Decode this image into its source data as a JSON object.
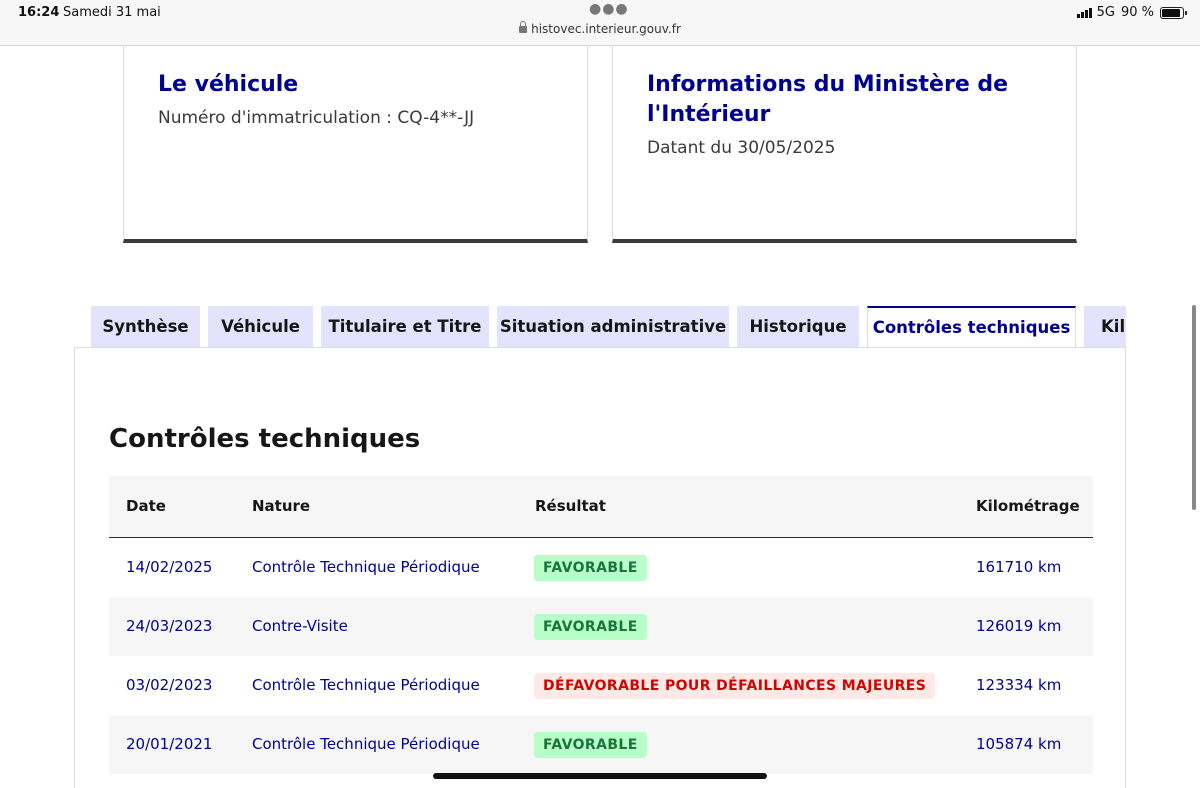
{
  "status_bar": {
    "time": "16:24",
    "date": "Samedi 31 mai",
    "url": "histovec.interieur.gouv.fr",
    "network": "5G",
    "battery": "90 %",
    "battery_level": 0.9
  },
  "cards": {
    "vehicle": {
      "title": "Le véhicule",
      "text": "Numéro d'immatriculation : CQ-4**-JJ"
    },
    "ministry": {
      "title_line1": "Informations du Ministère de",
      "title_line2": "l'Intérieur",
      "text": "Datant du 30/05/2025"
    }
  },
  "tabs": [
    {
      "label": "Synthèse",
      "active": false
    },
    {
      "label": "Véhicule",
      "active": false
    },
    {
      "label": "Titulaire et Titre",
      "active": false
    },
    {
      "label": "Situation administrative",
      "active": false
    },
    {
      "label": "Historique",
      "active": false
    },
    {
      "label": "Contrôles techniques",
      "active": true
    },
    {
      "label": "Kil",
      "active": false
    }
  ],
  "section": {
    "title": "Contrôles techniques",
    "columns": [
      "Date",
      "Nature",
      "Résultat",
      "Kilométrage"
    ],
    "rows": [
      {
        "date": "14/02/2025",
        "nature": "Contrôle Technique Périodique",
        "result": "FAVORABLE",
        "status": "ok",
        "km": "161710 km"
      },
      {
        "date": "24/03/2023",
        "nature": "Contre-Visite",
        "result": "FAVORABLE",
        "status": "ok",
        "km": "126019 km"
      },
      {
        "date": "03/02/2023",
        "nature": "Contrôle Technique Périodique",
        "result": "DÉFAVORABLE POUR DÉFAILLANCES MAJEURES",
        "status": "ko",
        "km": "123334 km"
      },
      {
        "date": "20/01/2021",
        "nature": "Contrôle Technique Périodique",
        "result": "FAVORABLE",
        "status": "ok",
        "km": "105874 km"
      }
    ]
  },
  "colors": {
    "primary": "#000091",
    "tab_bg": "#e3e3fd",
    "success_bg": "#b8fec9",
    "success_text": "#18753c",
    "error_bg": "#ffe9e6",
    "error_text": "#ce0500"
  }
}
